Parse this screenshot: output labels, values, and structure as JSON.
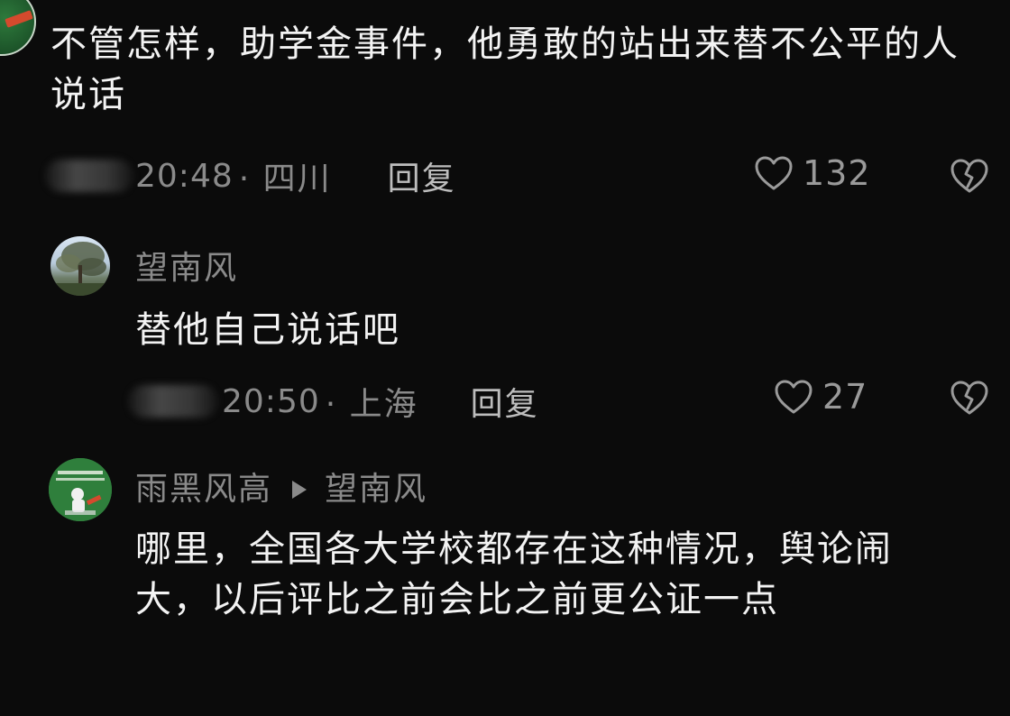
{
  "comments": [
    {
      "id": "top",
      "avatar": "green-avatar",
      "text": "不管怎样，助学金事件，他勇敢的站出来替不公平的人说话",
      "time": "20:48",
      "location": "· 四川",
      "reply_label": "回复",
      "likes": "132"
    },
    {
      "id": "wang",
      "username": "望南风",
      "avatar": "tree-photo-avatar",
      "text": "替他自己说话吧",
      "time": "20:50",
      "location": "· 上海",
      "reply_label": "回复",
      "likes": "27"
    },
    {
      "id": "yu",
      "username": "雨黑风高",
      "reply_to": "望南风",
      "avatar": "green-sign-avatar",
      "text": "哪里，全国各大学校都存在这种情况，舆论闹大，以后评比之前会比之前更公证一点"
    }
  ],
  "icons": {
    "like": "heart-outline-icon",
    "dislike": "broken-heart-icon",
    "reply_arrow": "play-triangle-icon"
  },
  "colors": {
    "background": "#0b0b0b",
    "text": "#f3f3f3",
    "meta": "#8a8a8a"
  }
}
